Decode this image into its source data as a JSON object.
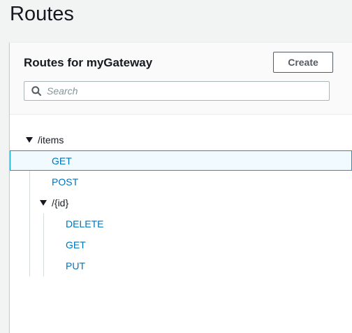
{
  "page": {
    "title": "Routes"
  },
  "panel": {
    "title": "Routes for myGateway",
    "create_label": "Create",
    "search_placeholder": "Search"
  },
  "tree": {
    "items": {
      "label": "/items",
      "expanded": true,
      "methods": [
        {
          "label": "GET",
          "selected": true
        },
        {
          "label": "POST",
          "selected": false
        }
      ],
      "id_folder": {
        "label": "/{id}",
        "expanded": true,
        "methods": [
          {
            "label": "DELETE"
          },
          {
            "label": "GET"
          },
          {
            "label": "PUT"
          }
        ]
      }
    }
  },
  "colors": {
    "link": "#0073bb",
    "selected_border": "#00a1c9",
    "selected_bg": "#f1faff",
    "tree_line": "#d5dbdb"
  },
  "icons": {
    "search": "search-icon",
    "toggle": "caret-down-icon"
  }
}
